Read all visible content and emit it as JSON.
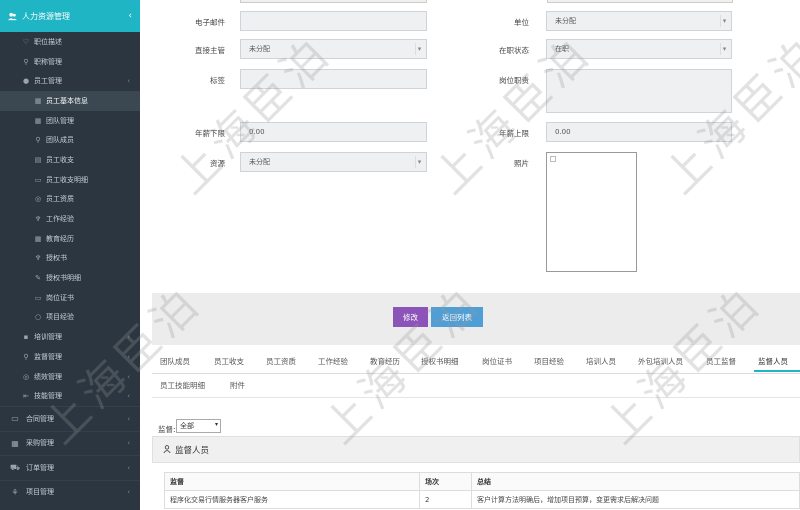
{
  "sidebar": {
    "header": {
      "label": "人力资源管理",
      "chevron": "‹"
    },
    "items": [
      {
        "label": "职位描述",
        "icon": "♡",
        "level": "l1",
        "chevron": ""
      },
      {
        "label": "职称管理",
        "icon": "⚲",
        "level": "l1",
        "chevron": ""
      },
      {
        "label": "员工管理",
        "icon": "●",
        "level": "l1",
        "chevron": "‹"
      },
      {
        "label": "员工基本信息",
        "icon": "▦",
        "level": "l2",
        "chevron": "",
        "active": true
      },
      {
        "label": "团队管理",
        "icon": "▦",
        "level": "l2",
        "chevron": ""
      },
      {
        "label": "团队成员",
        "icon": "⚲",
        "level": "l2",
        "chevron": ""
      },
      {
        "label": "员工收支",
        "icon": "▤",
        "level": "l2",
        "chevron": ""
      },
      {
        "label": "员工收支明细",
        "icon": "▭",
        "level": "l2",
        "chevron": ""
      },
      {
        "label": "员工资质",
        "icon": "◎",
        "level": "l2",
        "chevron": ""
      },
      {
        "label": "工作经验",
        "icon": "♆",
        "level": "l2",
        "chevron": ""
      },
      {
        "label": "教育经历",
        "icon": "▦",
        "level": "l2",
        "chevron": ""
      },
      {
        "label": "授权书",
        "icon": "♆",
        "level": "l2",
        "chevron": ""
      },
      {
        "label": "授权书明细",
        "icon": "✎",
        "level": "l2",
        "chevron": ""
      },
      {
        "label": "岗位证书",
        "icon": "▭",
        "level": "l2",
        "chevron": ""
      },
      {
        "label": "项目经验",
        "icon": "○",
        "level": "l2",
        "chevron": ""
      },
      {
        "label": "培训管理",
        "icon": "▪",
        "level": "l1",
        "chevron": "‹"
      },
      {
        "label": "监督管理",
        "icon": "⚲",
        "level": "l1",
        "chevron": "‹"
      },
      {
        "label": "绩效管理",
        "icon": "◎",
        "level": "l1",
        "chevron": "‹"
      },
      {
        "label": "技能管理",
        "icon": "⇤",
        "level": "l1",
        "chevron": "‹"
      }
    ],
    "groups": [
      {
        "label": "合同管理",
        "icon": "▭",
        "chevron": "‹"
      },
      {
        "label": "采购管理",
        "icon": "▦",
        "chevron": "‹"
      },
      {
        "label": "订单管理",
        "icon": "⛟",
        "chevron": "‹"
      },
      {
        "label": "项目管理",
        "icon": "⚘",
        "chevron": "‹"
      }
    ]
  },
  "form": {
    "email_label": "电子邮件",
    "email_value": "",
    "unit_label": "单位",
    "unit_value": "未分配",
    "supervisor_label": "直接主管",
    "supervisor_value": "未分配",
    "status_label": "在职状态",
    "status_value": "在职",
    "tag_label": "标签",
    "tag_value": "",
    "duty_label": "岗位职责",
    "duty_value": "",
    "salary_min_label": "年薪下限",
    "salary_min_value": "0.00",
    "salary_max_label": "年薪上限",
    "salary_max_value": "0.00",
    "source_label": "资源",
    "source_value": "未分配",
    "photo_label": "照片"
  },
  "buttons": {
    "edit": "修改",
    "back": "返回列表"
  },
  "tabs": {
    "row1": [
      "团队成员",
      "员工收支",
      "员工资质",
      "工作经验",
      "教育经历",
      "授权书明细",
      "岗位证书",
      "项目经验",
      "培训人员",
      "外包培训人员",
      "员工监督",
      "监督人员"
    ],
    "row2": [
      "员工技能明细",
      "附件"
    ],
    "active": "监督人员"
  },
  "filter": {
    "label": "监督:",
    "value": "全部"
  },
  "panel": {
    "title": "监督人员"
  },
  "table": {
    "headers": [
      "监督",
      "场次",
      "总结"
    ],
    "rows": [
      [
        "程序化交易行情服务器客户服务",
        "2",
        "客户计算方法明确后，增加项目预算，变更需求后解决问题"
      ]
    ]
  },
  "watermark": "上海臣泊",
  "colors": {
    "accent": "#1fb5c4",
    "sidebar_bg": "#2b3640",
    "edit_button": "#8c54b8",
    "back_button": "#4f9ed6"
  }
}
